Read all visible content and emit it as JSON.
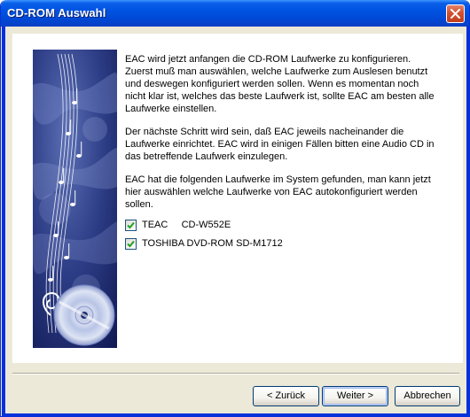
{
  "window": {
    "title": "CD-ROM Auswahl"
  },
  "titlebar": {
    "close_icon": "close-icon"
  },
  "body": {
    "paragraphs": [
      "EAC wird jetzt anfangen die CD-ROM Laufwerke zu konfigurieren. Zuerst muß man auswählen, welche Laufwerke zum Auslesen benutzt und deswegen konfiguriert werden sollen. Wenn es momentan noch nicht klar ist, welches das beste Laufwerk ist, sollte EAC am besten alle Laufwerke einstellen.",
      "Der nächste Schritt wird sein, daß EAC jeweils nacheinander die Laufwerke einrichtet. EAC wird in einigen Fällen bitten eine Audio CD in das betreffende Laufwerk einzulegen.",
      "EAC hat die folgenden Laufwerke im System gefunden, man kann jetzt hier auswählen welche Laufwerke von EAC autokonfiguriert werden sollen."
    ],
    "drives": [
      {
        "label": "TEAC     CD-W552E",
        "checked": true
      },
      {
        "label": "TOSHIBA DVD-ROM SD-M1712",
        "checked": true
      }
    ]
  },
  "buttons": {
    "back": "< Zurück",
    "next": "Weiter >",
    "cancel": "Abbrechen"
  },
  "colors": {
    "titlebar": "#0053e1",
    "frame": "#0831d9",
    "dialog_bg": "#ece9d8",
    "check": "#21a121"
  }
}
